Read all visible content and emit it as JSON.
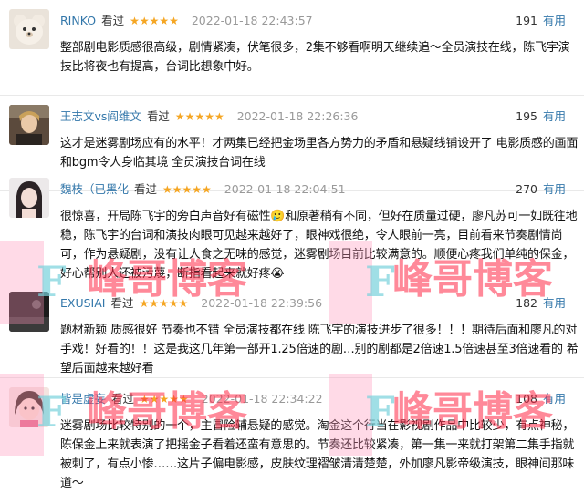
{
  "reviews": [
    {
      "author": "RINKO",
      "status": "看过",
      "stars": "★★★★★",
      "date": "2022-01-18 22:43:57",
      "votes": "191",
      "useful": "有用",
      "avatar": "teddy-bear-avatar",
      "content": "整部剧电影质感很高级，剧情紧凑，伏笔很多，2集不够看啊明天继续追～全员演技在线，陈飞宇演技比将夜也有提高，台词比想象中好。"
    },
    {
      "author": "王志文vs阎维文",
      "status": "看过",
      "stars": "★★★★★",
      "date": "2022-01-18 22:26:36",
      "votes": "195",
      "useful": "有用",
      "avatar": "person-photo-avatar",
      "content": "这才是迷雾剧场应有的水平！才两集已经把金场里各方势力的矛盾和悬疑线铺设开了 电影质感的画面和bgm令人身临其境 全员演技台词在线"
    },
    {
      "author": "魏枝（已黑化",
      "status": "看过",
      "stars": "★★★★★",
      "date": "2022-01-18 22:04:51",
      "votes": "270",
      "useful": "有用",
      "avatar": "woman-photo-avatar",
      "content": "很惊喜，开局陈飞宇的旁白声音好有磁性🥲和原著稍有不同，但好在质量过硬，廖凡苏可一如既往地稳，陈飞宇的台词和演技肉眼可见越来越好了，眼神戏很绝，令人眼前一亮，目前看来节奏剧情尚可，作为悬疑剧，没有让人食之无味的感觉，迷雾剧场目前比较满意的。顺便心疼我们单纯的保金，好心帮别人还被污蔑，断指看起来就好疼😭"
    },
    {
      "author": "EXUSIAI",
      "status": "看过",
      "stars": "★★★★★",
      "date": "2022-01-18 22:39:56",
      "votes": "182",
      "useful": "有用",
      "avatar": "dark-photo-avatar",
      "content": "题材新颖 质感很好 节奏也不错 全员演技都在线 陈飞宇的演技进步了很多！！！期待后面和廖凡的对手戏！好看的！！这是我这几年第一部开1.25倍速的剧…别的剧都是2倍速1.5倍速甚至3倍速看的 希望后面越来越好看"
    },
    {
      "author": "皆是虚妄",
      "status": "看过",
      "stars": "★★★★★",
      "date": "2022-01-18 22:34:22",
      "votes": "108",
      "useful": "有用",
      "avatar": "child-photo-avatar",
      "content": "迷雾剧场比较特别的一个，主冒险辅悬疑的感觉。淘金这个行当在影视剧作品中比较少，有点神秘，陈保金上来就表演了把摇金子看着还蛮有意思的。节奏还比较紧凑，第一集一来就打架第二集手指就被刺了，有点小惨……这片子偏电影感，皮肤纹理褶皱清清楚楚，外加廖凡影帝级演技，眼神间那味道～"
    }
  ],
  "watermarks": [
    "峰哥博客",
    "峰哥博客",
    "峰哥博客",
    "峰哥博客"
  ],
  "watermark_letter": "F",
  "colors": {
    "author": "#3377aa",
    "stars": "#f5a623",
    "date": "#999999",
    "watermark": "#ff2846"
  }
}
